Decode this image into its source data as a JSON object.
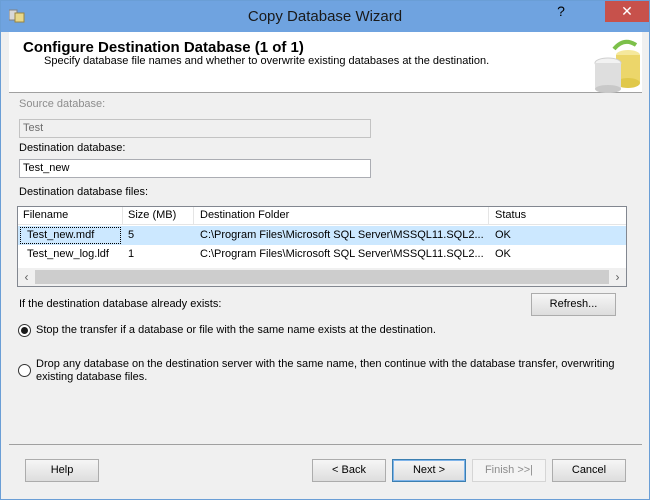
{
  "window": {
    "title": "Copy Database Wizard"
  },
  "header": {
    "title": "Configure Destination Database (1 of 1)",
    "subtitle": "Specify database file names and whether to overwrite existing databases at the destination."
  },
  "source": {
    "label": "Source database:",
    "value": "Test"
  },
  "destination": {
    "label": "Destination database:",
    "value": "Test_new"
  },
  "files": {
    "label": "Destination database files:",
    "columns": [
      "Filename",
      "Size (MB)",
      "Destination Folder",
      "Status"
    ],
    "rows": [
      {
        "filename": "Test_new.mdf",
        "size": "5",
        "folder": "C:\\Program Files\\Microsoft SQL Server\\MSSQL11.SQL2...",
        "status": "OK"
      },
      {
        "filename": "Test_new_log.ldf",
        "size": "1",
        "folder": "C:\\Program Files\\Microsoft SQL Server\\MSSQL11.SQL2...",
        "status": "OK"
      }
    ]
  },
  "exists": {
    "label": "If the destination database already exists:",
    "refresh": "Refresh...",
    "option_stop": "Stop the transfer if a database or file with the same name exists at the destination.",
    "option_drop": "Drop any database on the destination server with the same name, then continue with the database transfer, overwriting existing database files.",
    "selected": "stop"
  },
  "footer": {
    "help": "Help",
    "back": "< Back",
    "next": "Next >",
    "finish": "Finish >>|",
    "cancel": "Cancel"
  },
  "icons": {
    "help": "help-icon",
    "close": "close-icon",
    "app": "app-icon",
    "database": "database-icon"
  }
}
